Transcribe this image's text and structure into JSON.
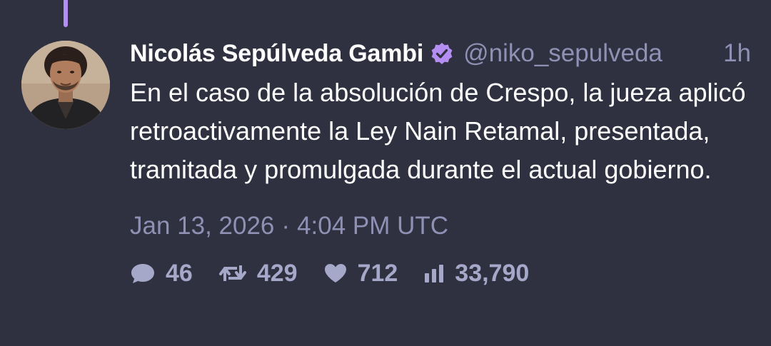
{
  "post": {
    "author": {
      "display_name": "Nicolás Sepúlveda Gambi",
      "handle": "@niko_sepulveda",
      "verified": true,
      "avatar_alt": "profile photo"
    },
    "time_ago": "1h",
    "text": "En el caso de la absolución de Crespo, la jueza aplicó retroactivamente la Ley Nain Retamal, presentada, tramitada y promulgada durante el actual gobierno.",
    "date": "Jan 13, 2026",
    "separator": "·",
    "time": "4:04 PM UTC",
    "stats": {
      "replies": "46",
      "reposts": "429",
      "likes": "712",
      "views": "33,790"
    }
  },
  "colors": {
    "background": "#2f3040",
    "accent": "#b48ef0",
    "muted_text": "#8f91b4",
    "stat_text": "#a6a8c9"
  },
  "icons": {
    "verified": "verified-badge-icon",
    "replies": "comment-icon",
    "reposts": "repost-icon",
    "likes": "heart-icon",
    "views": "bar-chart-icon"
  }
}
